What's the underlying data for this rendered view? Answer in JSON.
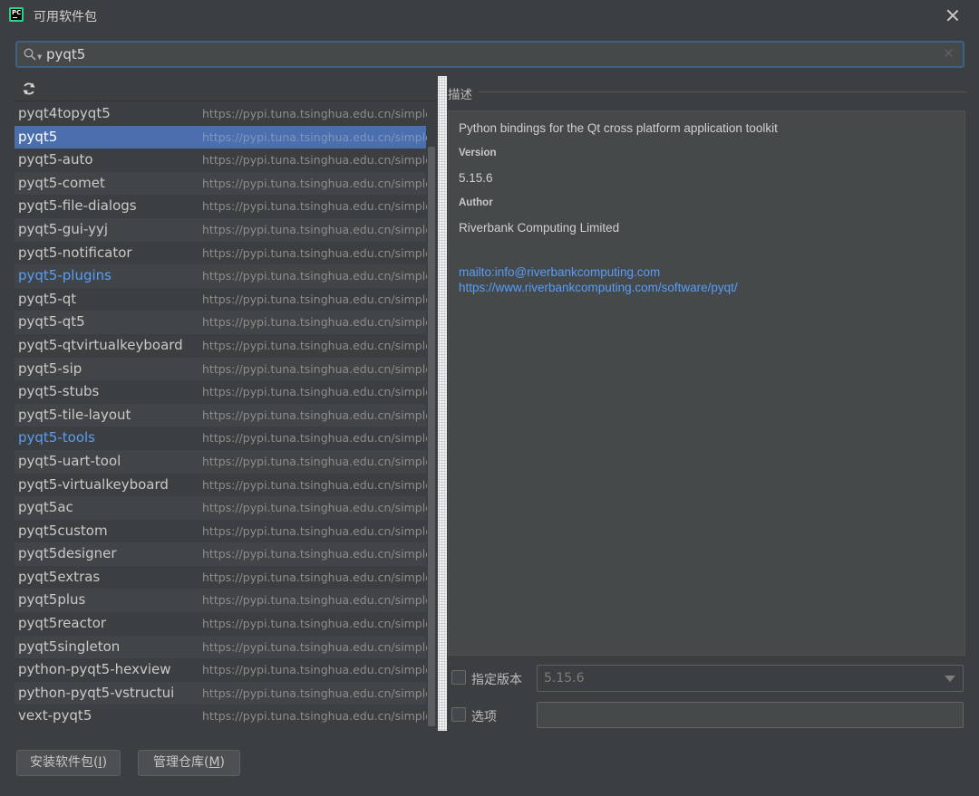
{
  "window": {
    "title": "可用软件包",
    "app_icon": "PC"
  },
  "search": {
    "value": "pyqt5",
    "placeholder": ""
  },
  "packages": [
    {
      "name": "pyqt4topyqt5",
      "repo": "https://pypi.tuna.tsinghua.edu.cn/simple/"
    },
    {
      "name": "pyqt5",
      "repo": "https://pypi.tuna.tsinghua.edu.cn/simple/",
      "selected": true
    },
    {
      "name": "pyqt5-auto",
      "repo": "https://pypi.tuna.tsinghua.edu.cn/simple/"
    },
    {
      "name": "pyqt5-comet",
      "repo": "https://pypi.tuna.tsinghua.edu.cn/simple/"
    },
    {
      "name": "pyqt5-file-dialogs",
      "repo": "https://pypi.tuna.tsinghua.edu.cn/simple/"
    },
    {
      "name": "pyqt5-gui-yyj",
      "repo": "https://pypi.tuna.tsinghua.edu.cn/simple/"
    },
    {
      "name": "pyqt5-notificator",
      "repo": "https://pypi.tuna.tsinghua.edu.cn/simple/"
    },
    {
      "name": "pyqt5-plugins",
      "repo": "https://pypi.tuna.tsinghua.edu.cn/simple/",
      "installed": true
    },
    {
      "name": "pyqt5-qt",
      "repo": "https://pypi.tuna.tsinghua.edu.cn/simple/"
    },
    {
      "name": "pyqt5-qt5",
      "repo": "https://pypi.tuna.tsinghua.edu.cn/simple/"
    },
    {
      "name": "pyqt5-qtvirtualkeyboard",
      "repo": "https://pypi.tuna.tsinghua.edu.cn/simple/"
    },
    {
      "name": "pyqt5-sip",
      "repo": "https://pypi.tuna.tsinghua.edu.cn/simple/"
    },
    {
      "name": "pyqt5-stubs",
      "repo": "https://pypi.tuna.tsinghua.edu.cn/simple/"
    },
    {
      "name": "pyqt5-tile-layout",
      "repo": "https://pypi.tuna.tsinghua.edu.cn/simple/"
    },
    {
      "name": "pyqt5-tools",
      "repo": "https://pypi.tuna.tsinghua.edu.cn/simple/",
      "installed": true
    },
    {
      "name": "pyqt5-uart-tool",
      "repo": "https://pypi.tuna.tsinghua.edu.cn/simple/"
    },
    {
      "name": "pyqt5-virtualkeyboard",
      "repo": "https://pypi.tuna.tsinghua.edu.cn/simple/"
    },
    {
      "name": "pyqt5ac",
      "repo": "https://pypi.tuna.tsinghua.edu.cn/simple/"
    },
    {
      "name": "pyqt5custom",
      "repo": "https://pypi.tuna.tsinghua.edu.cn/simple/"
    },
    {
      "name": "pyqt5designer",
      "repo": "https://pypi.tuna.tsinghua.edu.cn/simple/"
    },
    {
      "name": "pyqt5extras",
      "repo": "https://pypi.tuna.tsinghua.edu.cn/simple/"
    },
    {
      "name": "pyqt5plus",
      "repo": "https://pypi.tuna.tsinghua.edu.cn/simple/"
    },
    {
      "name": "pyqt5reactor",
      "repo": "https://pypi.tuna.tsinghua.edu.cn/simple/"
    },
    {
      "name": "pyqt5singleton",
      "repo": "https://pypi.tuna.tsinghua.edu.cn/simple/"
    },
    {
      "name": "python-pyqt5-hexview",
      "repo": "https://pypi.tuna.tsinghua.edu.cn/simple/"
    },
    {
      "name": "python-pyqt5-vstructui",
      "repo": "https://pypi.tuna.tsinghua.edu.cn/simple/"
    },
    {
      "name": "vext-pyqt5",
      "repo": "https://pypi.tuna.tsinghua.edu.cn/simple/"
    }
  ],
  "description": {
    "label": "描述",
    "summary": "Python bindings for the Qt cross platform application toolkit",
    "version_heading": "Version",
    "version": "5.15.6",
    "author_heading": "Author",
    "author": "Riverbank Computing Limited",
    "links": [
      "mailto:info@riverbankcomputing.com",
      "https://www.riverbankcomputing.com/software/pyqt/"
    ]
  },
  "options": {
    "specify_version_label": "指定版本",
    "specify_version_checked": false,
    "version_value": "5.15.6",
    "options_label": "选项",
    "options_checked": false,
    "options_value": ""
  },
  "buttons": {
    "install_text": "安装软件包(",
    "install_key": "I",
    "manage_text": "管理仓库(",
    "manage_key": "M",
    "close_paren": ")"
  },
  "colors": {
    "accent": "#4b6eaf",
    "link": "#589df6",
    "background": "#3c3f41"
  }
}
